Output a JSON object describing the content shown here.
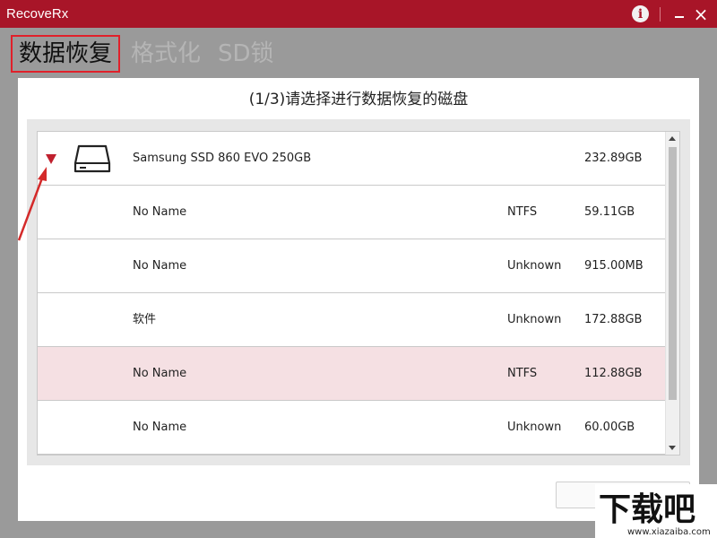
{
  "app": {
    "title": "RecoveRx",
    "info_symbol": "i",
    "minimize_symbol": "",
    "close_symbol": "×"
  },
  "tabs": [
    {
      "label": "数据恢复",
      "active": true
    },
    {
      "label": "格式化",
      "active": false
    },
    {
      "label": "SD锁",
      "active": false
    }
  ],
  "heading": "(1/3)请选择进行数据恢复的磁盘",
  "disk": {
    "name": "Samsung SSD 860 EVO 250GB",
    "size": "232.89GB",
    "expanded": true,
    "icon": "drive-icon"
  },
  "partitions": [
    {
      "name": "No Name",
      "filesystem": "NTFS",
      "size": "59.11GB",
      "selected": false
    },
    {
      "name": "No Name",
      "filesystem": "Unknown",
      "size": "915.00MB",
      "selected": false
    },
    {
      "name": "软件",
      "filesystem": "Unknown",
      "size": "172.88GB",
      "selected": false
    },
    {
      "name": "No Name",
      "filesystem": "NTFS",
      "size": "112.88GB",
      "selected": true
    },
    {
      "name": "No Name",
      "filesystem": "Unknown",
      "size": "60.00GB",
      "selected": false
    }
  ],
  "next_button": {
    "label": ""
  },
  "watermark": {
    "logo_text": "下载吧",
    "url_text": "www.xiazaiba.com"
  },
  "colors": {
    "titlebar": "#a81528",
    "accent": "#c0202e",
    "selected_row": "#f5e0e3",
    "overlay": "#9a9a9a"
  }
}
